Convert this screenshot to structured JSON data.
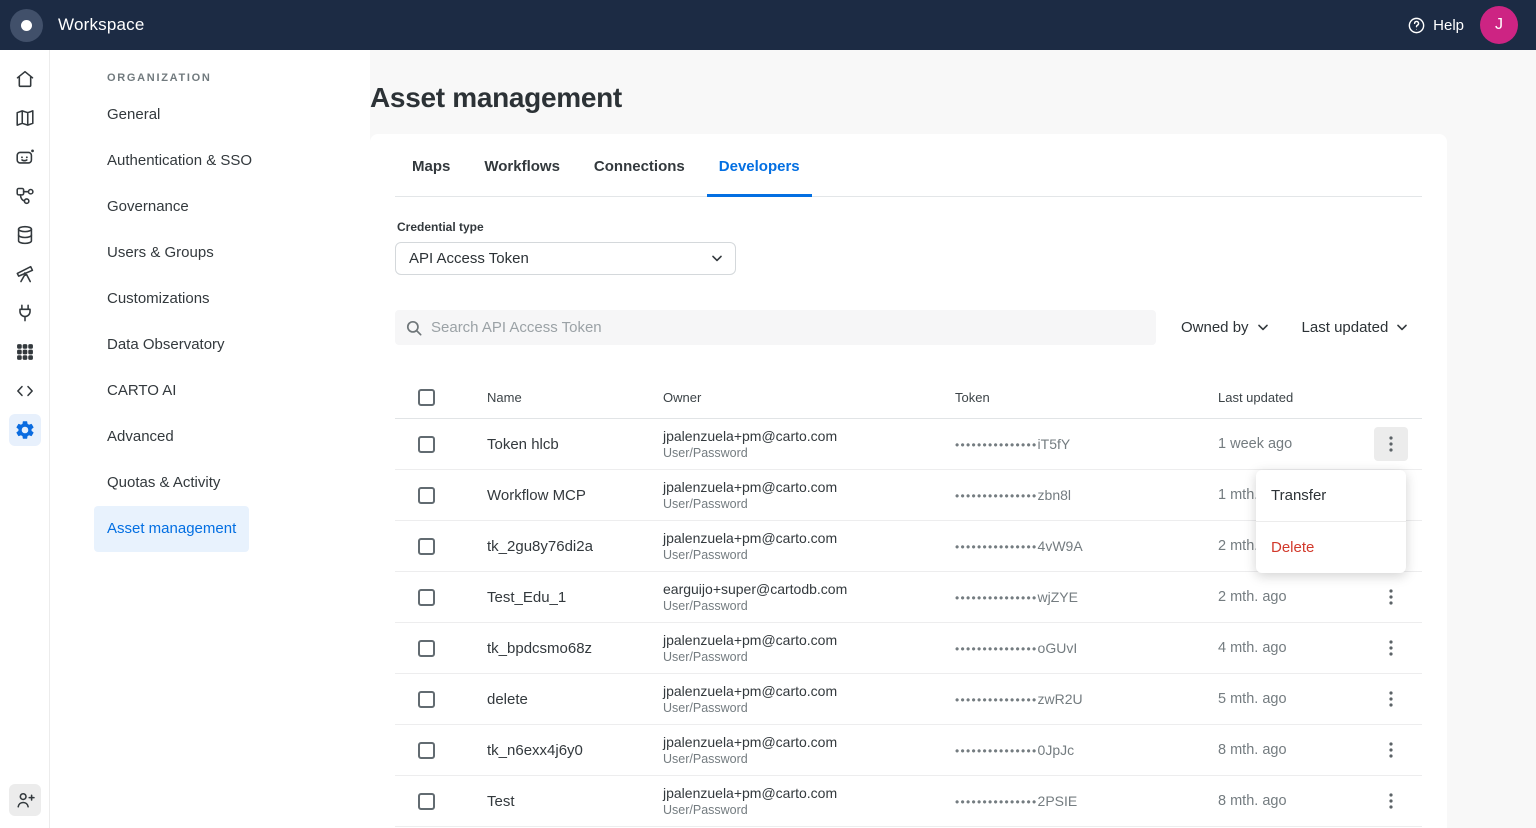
{
  "topbar": {
    "app_name": "Workspace",
    "help_label": "Help",
    "avatar_initial": "J"
  },
  "rail": {
    "icons": [
      "home",
      "maps",
      "ai-agents",
      "workflows",
      "data-explorer",
      "data-observatory",
      "connections",
      "applications",
      "developers",
      "settings"
    ],
    "bottom_icon": "invite-user",
    "active_icon": "settings"
  },
  "sidebar": {
    "section_title": "ORGANIZATION",
    "items": [
      {
        "label": "General",
        "active": false
      },
      {
        "label": "Authentication & SSO",
        "active": false
      },
      {
        "label": "Governance",
        "active": false
      },
      {
        "label": "Users & Groups",
        "active": false
      },
      {
        "label": "Customizations",
        "active": false
      },
      {
        "label": "Data Observatory",
        "active": false
      },
      {
        "label": "CARTO AI",
        "active": false
      },
      {
        "label": "Advanced",
        "active": false
      },
      {
        "label": "Quotas & Activity",
        "active": false
      },
      {
        "label": "Asset management",
        "active": true
      }
    ]
  },
  "main": {
    "title": "Asset management",
    "tabs": [
      {
        "label": "Maps",
        "active": false
      },
      {
        "label": "Workflows",
        "active": false
      },
      {
        "label": "Connections",
        "active": false
      },
      {
        "label": "Developers",
        "active": true
      }
    ],
    "credential_type": {
      "label": "Credential type",
      "value": "API Access Token"
    },
    "search": {
      "placeholder": "Search API Access Token"
    },
    "filters": {
      "owned_by_label": "Owned by",
      "last_updated_label": "Last updated"
    },
    "table": {
      "columns": [
        "Name",
        "Owner",
        "Token",
        "Last updated"
      ],
      "rows": [
        {
          "name": "Token hlcb",
          "owner": "jpalenzuela+pm@carto.com",
          "credential": "User/Password",
          "token_mask": "•••••••••••••••",
          "token_suffix": "iT5fY",
          "last_updated": "1 week ago",
          "menu_open": true
        },
        {
          "name": "Workflow MCP",
          "owner": "jpalenzuela+pm@carto.com",
          "credential": "User/Password",
          "token_mask": "•••••••••••••••",
          "token_suffix": "zbn8l",
          "last_updated": "1 mth. ago",
          "menu_open": false
        },
        {
          "name": "tk_2gu8y76di2a",
          "owner": "jpalenzuela+pm@carto.com",
          "credential": "User/Password",
          "token_mask": "•••••••••••••••",
          "token_suffix": "4vW9A",
          "last_updated": "2 mth. ago",
          "menu_open": false
        },
        {
          "name": "Test_Edu_1",
          "owner": "earguijo+super@cartodb.com",
          "credential": "User/Password",
          "token_mask": "•••••••••••••••",
          "token_suffix": "wjZYE",
          "last_updated": "2 mth. ago",
          "menu_open": false
        },
        {
          "name": "tk_bpdcsmo68z",
          "owner": "jpalenzuela+pm@carto.com",
          "credential": "User/Password",
          "token_mask": "•••••••••••••••",
          "token_suffix": "oGUvI",
          "last_updated": "4 mth. ago",
          "menu_open": false
        },
        {
          "name": "delete",
          "owner": "jpalenzuela+pm@carto.com",
          "credential": "User/Password",
          "token_mask": "•••••••••••••••",
          "token_suffix": "zwR2U",
          "last_updated": "5 mth. ago",
          "menu_open": false
        },
        {
          "name": "tk_n6exx4j6y0",
          "owner": "jpalenzuela+pm@carto.com",
          "credential": "User/Password",
          "token_mask": "•••••••••••••••",
          "token_suffix": "0JpJc",
          "last_updated": "8 mth. ago",
          "menu_open": false
        },
        {
          "name": "Test",
          "owner": "jpalenzuela+pm@carto.com",
          "credential": "User/Password",
          "token_mask": "•••••••••••••••",
          "token_suffix": "2PSIE",
          "last_updated": "8 mth. ago",
          "menu_open": false
        }
      ]
    },
    "context_menu": {
      "transfer_label": "Transfer",
      "delete_label": "Delete"
    }
  },
  "colors": {
    "topbar_bg": "#1c2b44",
    "accent_blue": "#036fe2",
    "avatar_pink": "#cd2483",
    "danger_red": "#d2392b",
    "active_item_bg": "#e8f2fd",
    "page_bg": "#f8f8f8"
  }
}
